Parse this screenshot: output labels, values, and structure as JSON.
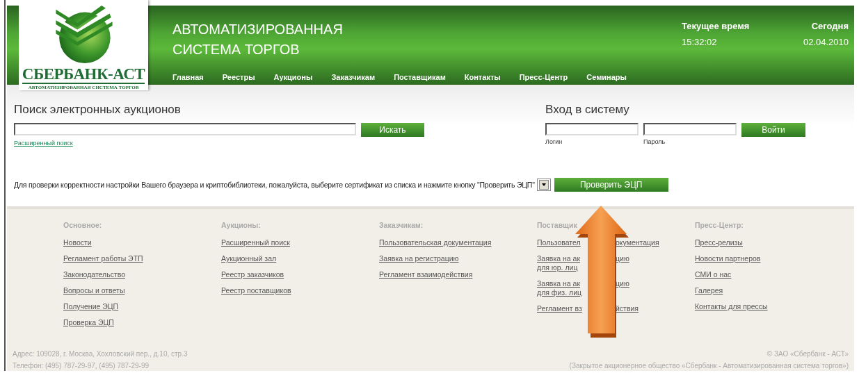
{
  "header": {
    "logo": {
      "name": "СБЕРБАНК-АСТ",
      "tagline": "АВТОМАТИЗИРОВАННАЯ СИСТЕМА ТОРГОВ"
    },
    "title_lines": [
      "АВТОМАТИЗИРОВАННАЯ",
      "СИСТЕМА ТОРГОВ"
    ],
    "clock": [
      {
        "label": "Текущее время",
        "value": "15:32:02"
      },
      {
        "label": "Сегодня",
        "value": "02.04.2010"
      }
    ],
    "nav": [
      "Главная",
      "Реестры",
      "Аукционы",
      "Заказчикам",
      "Поставщикам",
      "Контакты",
      "Пресс-Центр",
      "Семинары"
    ]
  },
  "search": {
    "title": "Поиск электронных аукционов",
    "button": "Искать",
    "advanced_link": "Расширенный поиск"
  },
  "login": {
    "title": "Вход в систему",
    "fields": [
      {
        "label": "Логин"
      },
      {
        "label": "Пароль"
      }
    ],
    "button": "Войти"
  },
  "certificate": {
    "text": "Для проверки корректности настройки Вашего браузера и криптобиблиотеки, пожалуйста, выберите сертификат из списка и нажмите кнопку \"Проверить ЭЦП\"",
    "button": "Проверить ЭЦП"
  },
  "footer": {
    "columns": [
      {
        "title": "Основное:",
        "links": [
          [
            {
              "text": "Новости"
            }
          ],
          [
            {
              "text": "Регламент работы ЭТП"
            }
          ],
          [
            {
              "text": "Законодательство"
            }
          ],
          [
            {
              "text": "Вопросы и ответы"
            }
          ],
          [
            {
              "text": "Получение ЭЦП"
            }
          ],
          [
            {
              "text": "Проверка ЭЦП"
            }
          ]
        ]
      },
      {
        "title": "Аукционы:",
        "links": [
          [
            {
              "text": "Расширенный поиск"
            }
          ],
          [
            {
              "text": "Аукционный зал"
            }
          ],
          [
            {
              "text": "Реестр заказчиков"
            }
          ],
          [
            {
              "text": "Реестр поставщиков"
            }
          ]
        ]
      },
      {
        "title": "Заказчикам:",
        "links": [
          [
            {
              "text": "Пользовательская документация"
            }
          ],
          [
            {
              "text": "Заявка на регистрацию"
            }
          ],
          [
            {
              "text": "Регламент взаимодействия"
            }
          ]
        ]
      },
      {
        "title": "Поставщик",
        "links": [
          [
            {
              "text": "Пользовател",
              "after": "окументация"
            }
          ],
          [
            {
              "text": "Заявка на ак",
              "after": "цию"
            },
            {
              "text": "для юр. лиц"
            }
          ],
          [
            {
              "text": "Заявка на ак",
              "after": "цию"
            },
            {
              "text": "для физ. лиц"
            }
          ],
          [
            {
              "text": "Регламент вз",
              "after": "йствия"
            }
          ]
        ]
      },
      {
        "title": "Пресс-Центр:",
        "links": [
          [
            {
              "text": "Пресс-релизы"
            }
          ],
          [
            {
              "text": "Новости партнеров"
            }
          ],
          [
            {
              "text": "СМИ о нас"
            }
          ],
          [
            {
              "text": "Галерея"
            }
          ],
          [
            {
              "text": "Контакты для прессы"
            }
          ]
        ]
      }
    ],
    "address": [
      "Адрес: 109028, г. Москва, Хохловский пер., д.10, стр.3",
      "Телефон: (495) 787-29-97, (495) 787-29-99"
    ],
    "copyright": [
      "© ЗАО «Сбербанк - АСТ»",
      "(Закрытое акционерное общество «Сбербанк - Автоматизированная система торгов»)"
    ]
  }
}
